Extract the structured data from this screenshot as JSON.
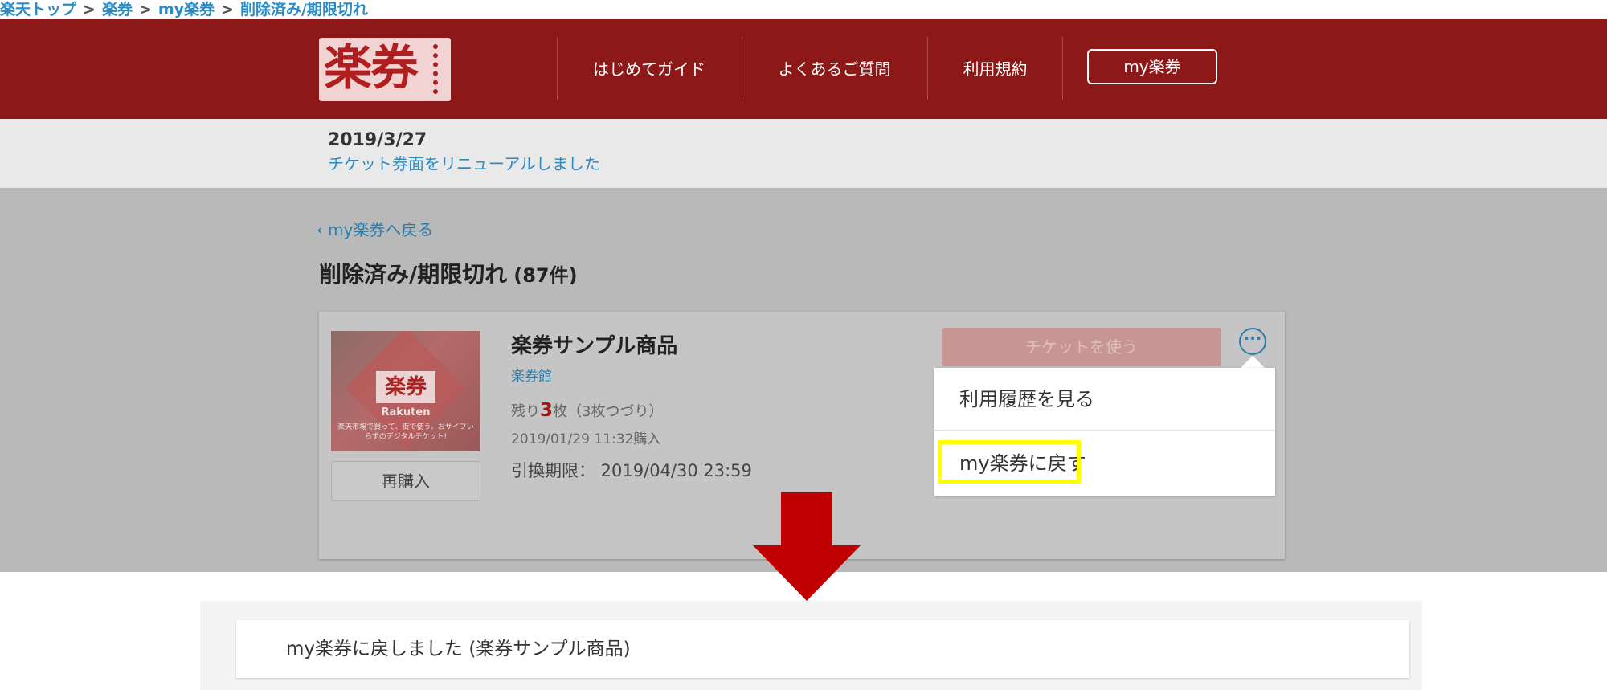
{
  "breadcrumb": {
    "items": [
      "楽天トップ",
      "楽券",
      "my楽券",
      "削除済み/期限切れ"
    ],
    "separator": ">"
  },
  "header": {
    "logo_text": "楽券",
    "nav": [
      "はじめてガイド",
      "よくあるご質問",
      "利用規約"
    ],
    "my_button": "my楽券"
  },
  "notice": {
    "date": "2019/3/27",
    "link": "チケット券面をリニューアルしました"
  },
  "main": {
    "back_link": "my楽券へ戻る",
    "title": "削除済み/期限切れ",
    "count": "(87件)"
  },
  "ticket": {
    "name": "楽券サンプル商品",
    "venue": "楽券館",
    "remaining_prefix": "残り",
    "remaining_count": "3",
    "remaining_suffix": "枚（3枚つづり）",
    "purchased": "2019/01/29 11:32購入",
    "expiry": "引換期限： 2019/04/30 23:59",
    "use_button": "チケットを使う",
    "rebuy_button": "再購入",
    "thumbnail": {
      "logo": "楽券",
      "brand": "Rakuten",
      "caption": "楽天市場で買って、街で使う。おサイフいらずのデジタルチケット!"
    },
    "more_icon": "more-icon"
  },
  "popup": {
    "items": [
      "利用履歴を見る",
      "my楽券に戻す"
    ]
  },
  "toast": {
    "message": "my楽券に戻しました (楽券サンプル商品)"
  },
  "colors": {
    "header_bg": "#8c1818",
    "link": "#2a8cc4",
    "highlight": "#ffff00",
    "arrow": "#c00000"
  }
}
